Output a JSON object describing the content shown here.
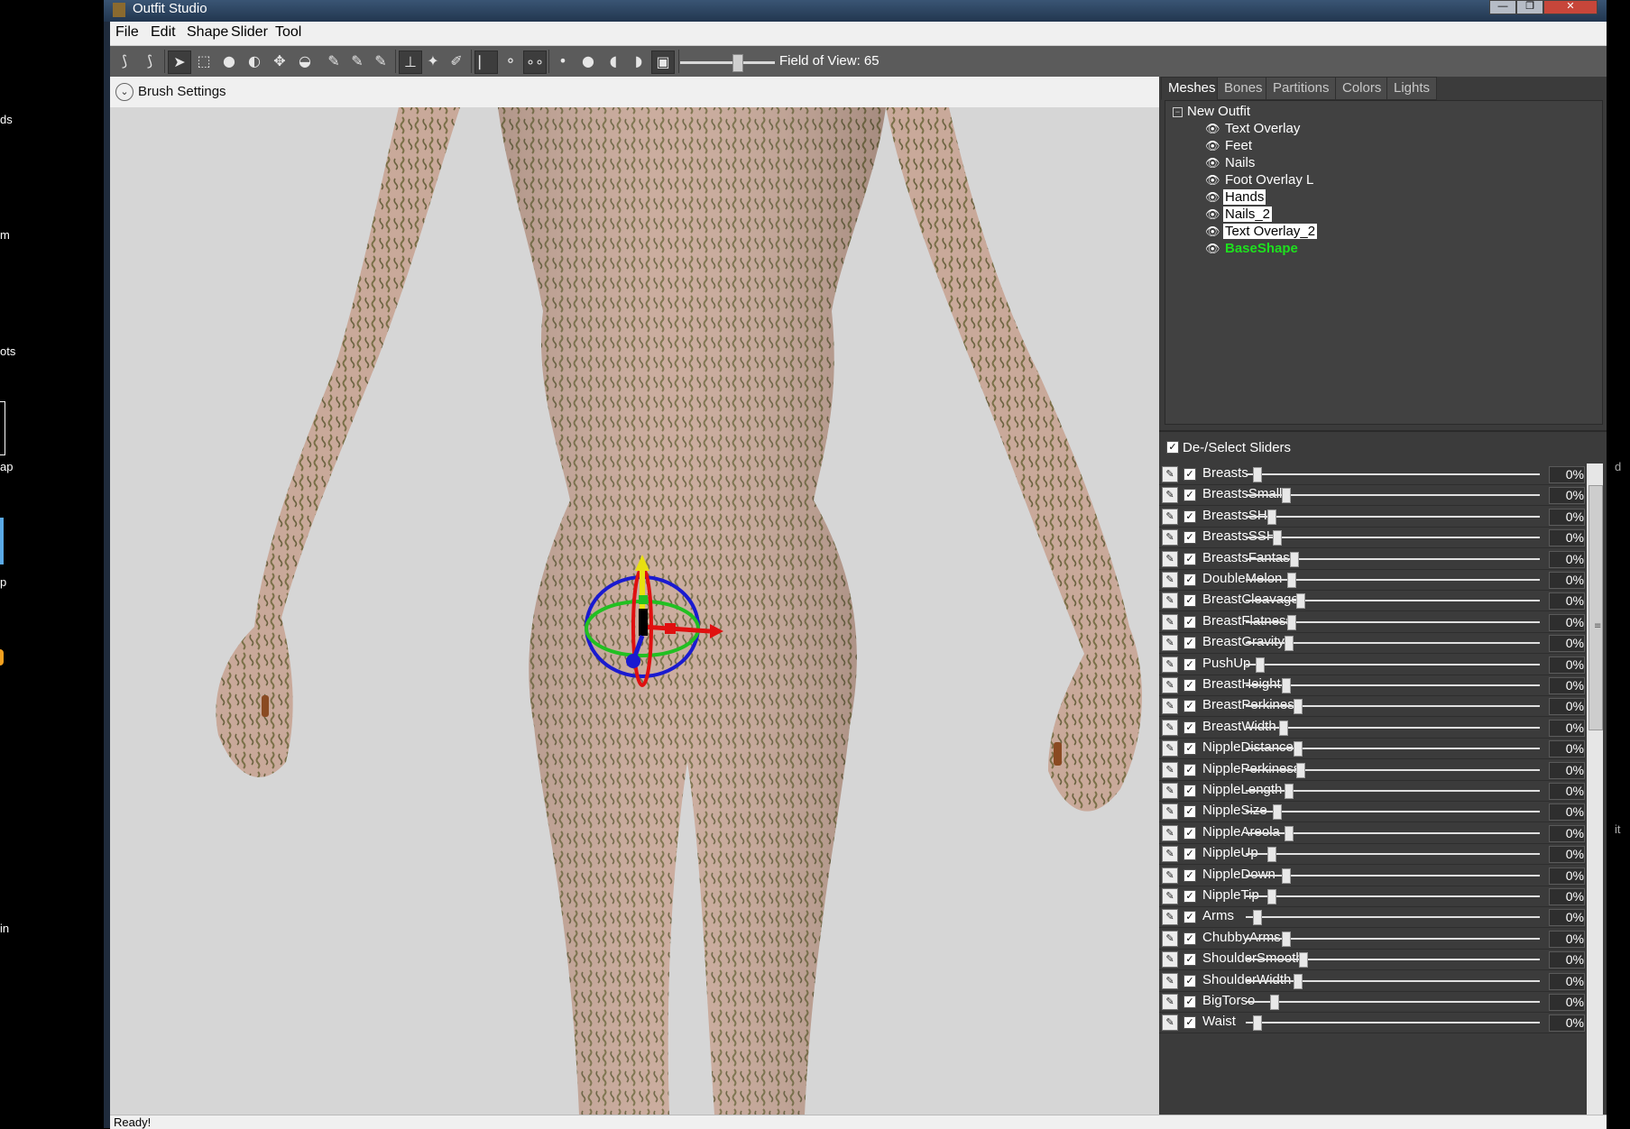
{
  "desktop": {
    "labels": [
      "ds",
      "m",
      "ots",
      "ap",
      "p",
      "in"
    ],
    "right_labels": [
      "d",
      "it"
    ]
  },
  "window": {
    "title": "Outfit Studio",
    "buttons": [
      "—",
      "❐",
      "✕"
    ]
  },
  "menu": [
    "File",
    "Edit",
    "Shape",
    "Slider",
    "Tool"
  ],
  "toolbar": {
    "fov_label": "Field of View: 65",
    "fov_value": 65
  },
  "viewport": {
    "brush_settings_label": "Brush Settings"
  },
  "tabs": [
    "Meshes",
    "Bones",
    "Partitions",
    "Colors",
    "Lights"
  ],
  "selected_tab": "Meshes",
  "tree": {
    "root": "New Outfit",
    "items": [
      {
        "name": "Text Overlay",
        "state": "normal"
      },
      {
        "name": "Feet",
        "state": "normal"
      },
      {
        "name": "Nails",
        "state": "normal"
      },
      {
        "name": "Foot Overlay L",
        "state": "normal"
      },
      {
        "name": "Hands",
        "state": "highlight"
      },
      {
        "name": "Nails_2",
        "state": "highlight"
      },
      {
        "name": "Text Overlay_2",
        "state": "highlight"
      },
      {
        "name": "BaseShape",
        "state": "active"
      }
    ]
  },
  "sliders_header": {
    "label": "De-/Select Sliders",
    "checked": true
  },
  "sliders": [
    {
      "name": "Breasts",
      "value": "0%",
      "pos": 0.0
    },
    {
      "name": "BreastsSmall",
      "value": "0%",
      "pos": 0.1
    },
    {
      "name": "BreastsSH",
      "value": "0%",
      "pos": 0.05
    },
    {
      "name": "BreastsSSH",
      "value": "0%",
      "pos": 0.07
    },
    {
      "name": "BreastsFantasy",
      "value": "0%",
      "pos": 0.13
    },
    {
      "name": "DoubleMelon",
      "value": "0%",
      "pos": 0.12
    },
    {
      "name": "BreastCleavage",
      "value": "0%",
      "pos": 0.15
    },
    {
      "name": "BreastFlatness",
      "value": "0%",
      "pos": 0.12
    },
    {
      "name": "BreastGravity",
      "value": "0%",
      "pos": 0.11
    },
    {
      "name": "PushUp",
      "value": "0%",
      "pos": 0.01
    },
    {
      "name": "BreastHeight",
      "value": "0%",
      "pos": 0.1
    },
    {
      "name": "BreastPerkiness",
      "value": "0%",
      "pos": 0.14
    },
    {
      "name": "BreastWidth",
      "value": "0%",
      "pos": 0.09
    },
    {
      "name": "NippleDistance",
      "value": "0%",
      "pos": 0.14
    },
    {
      "name": "NipplePerkiness",
      "value": "0%",
      "pos": 0.15
    },
    {
      "name": "NippleLength",
      "value": "0%",
      "pos": 0.11
    },
    {
      "name": "NippleSize",
      "value": "0%",
      "pos": 0.07
    },
    {
      "name": "NippleAreola",
      "value": "0%",
      "pos": 0.11
    },
    {
      "name": "NippleUp",
      "value": "0%",
      "pos": 0.05
    },
    {
      "name": "NippleDown",
      "value": "0%",
      "pos": 0.1
    },
    {
      "name": "NippleTip",
      "value": "0%",
      "pos": 0.05
    },
    {
      "name": "Arms",
      "value": "0%",
      "pos": 0.0
    },
    {
      "name": "ChubbyArms",
      "value": "0%",
      "pos": 0.1
    },
    {
      "name": "ShoulderSmooth",
      "value": "0%",
      "pos": 0.16
    },
    {
      "name": "ShoulderWidth",
      "value": "0%",
      "pos": 0.14
    },
    {
      "name": "BigTorso",
      "value": "0%",
      "pos": 0.06
    },
    {
      "name": "Waist",
      "value": "0%",
      "pos": 0.0
    }
  ],
  "status": {
    "text": "Ready!"
  }
}
